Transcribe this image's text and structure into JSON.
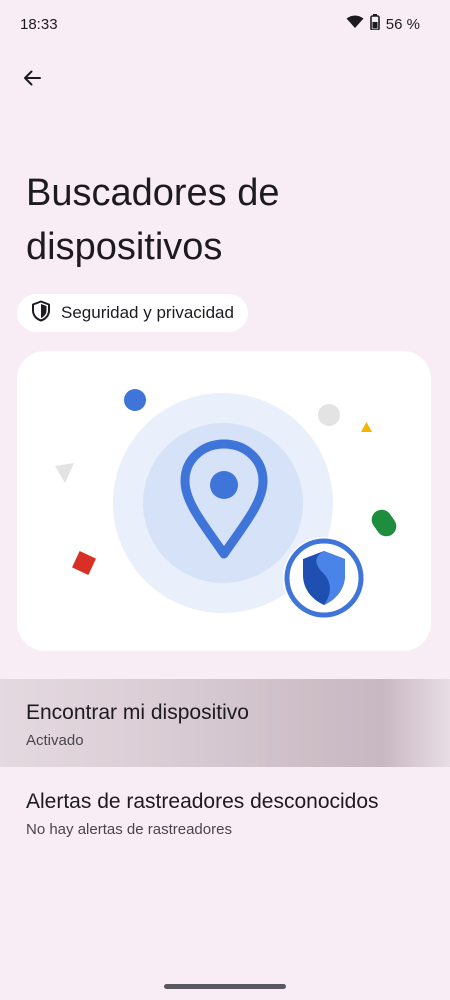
{
  "status_bar": {
    "time": "18:33",
    "battery": "56 %"
  },
  "header": {
    "title": "Buscadores de dispositivos"
  },
  "chip": {
    "label": "Seguridad y privacidad"
  },
  "settings": [
    {
      "title": "Encontrar mi dispositivo",
      "subtitle": "Activado"
    },
    {
      "title": "Alertas de rastreadores desconocidos",
      "subtitle": "No hay alertas de rastreadores"
    }
  ],
  "colors": {
    "background": "#f8edf5",
    "accent_blue": "#3f75d9",
    "card": "#ffffff"
  },
  "icons": [
    "back-arrow-icon",
    "wifi-icon",
    "battery-icon",
    "shield-icon",
    "location-pin-icon",
    "security-shield-icon"
  ]
}
